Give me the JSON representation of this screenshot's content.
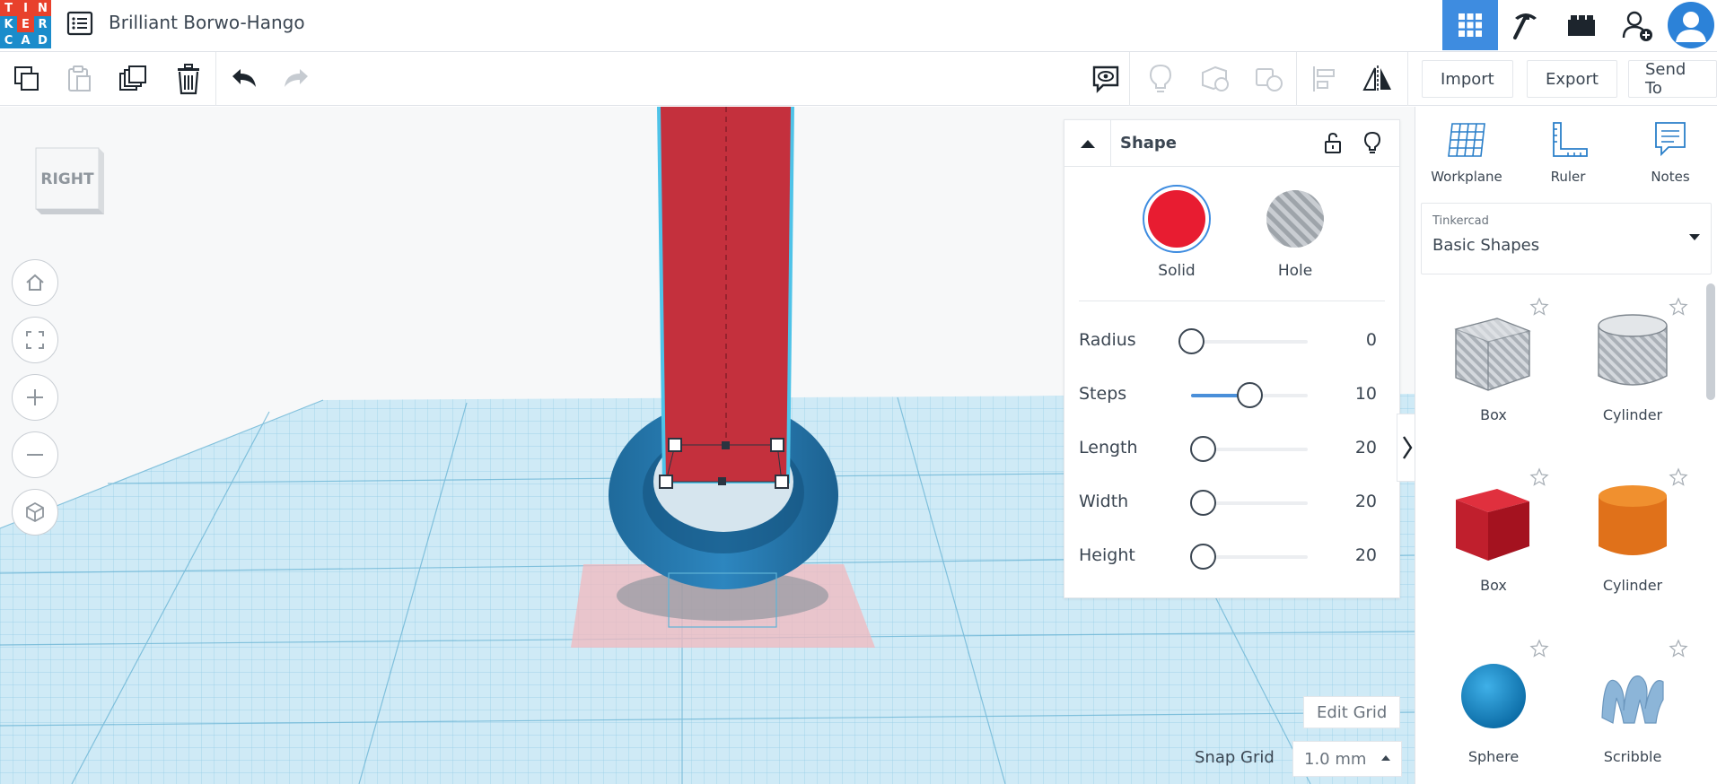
{
  "app": {
    "logo_letters": [
      "T",
      "I",
      "N",
      "K",
      "E",
      "R",
      "C",
      "A",
      "D"
    ],
    "logo_colors": [
      "#e8412c",
      "#e8412c",
      "#e8412c",
      "#1b8ccb",
      "#e8412c",
      "#1b8ccb",
      "#1b8ccb",
      "#1b8ccb",
      "#1b8ccb"
    ],
    "document_title": "Brilliant Borwo-Hango"
  },
  "topbar": {
    "grid_view": "3d-design-grid-icon",
    "circuits": "pickaxe-icon",
    "lego": "brick-icon",
    "invite": "add-user-icon",
    "accent": "#3e8ce0"
  },
  "toolbar": {
    "import_label": "Import",
    "export_label": "Export",
    "sendto_label": "Send To"
  },
  "viewport": {
    "view_cube_face": "RIGHT"
  },
  "shape_panel": {
    "title": "Shape",
    "solid_label": "Solid",
    "hole_label": "Hole",
    "solid_color": "#e81c31",
    "properties": [
      {
        "label": "Radius",
        "value": "0",
        "fraction": 0.0
      },
      {
        "label": "Steps",
        "value": "10",
        "fraction": 0.5
      },
      {
        "label": "Length",
        "value": "20",
        "fraction": 0.1
      },
      {
        "label": "Width",
        "value": "20",
        "fraction": 0.1
      },
      {
        "label": "Height",
        "value": "20",
        "fraction": 0.1
      }
    ]
  },
  "grid_controls": {
    "edit_grid_label": "Edit Grid",
    "snap_grid_label": "Snap Grid",
    "snap_value": "1.0 mm"
  },
  "sidebar": {
    "tools": [
      {
        "label": "Workplane",
        "icon": "workplane-icon"
      },
      {
        "label": "Ruler",
        "icon": "ruler-icon"
      },
      {
        "label": "Notes",
        "icon": "notes-icon"
      }
    ],
    "library_kicker": "Tinkercad",
    "library_value": "Basic Shapes",
    "shapes": [
      {
        "name": "Box",
        "kind": "box-hole"
      },
      {
        "name": "Cylinder",
        "kind": "cylinder-hole"
      },
      {
        "name": "Box",
        "kind": "box-red"
      },
      {
        "name": "Cylinder",
        "kind": "cylinder-orange"
      },
      {
        "name": "Sphere",
        "kind": "sphere-blue"
      },
      {
        "name": "Scribble",
        "kind": "scribble-blue"
      }
    ]
  }
}
